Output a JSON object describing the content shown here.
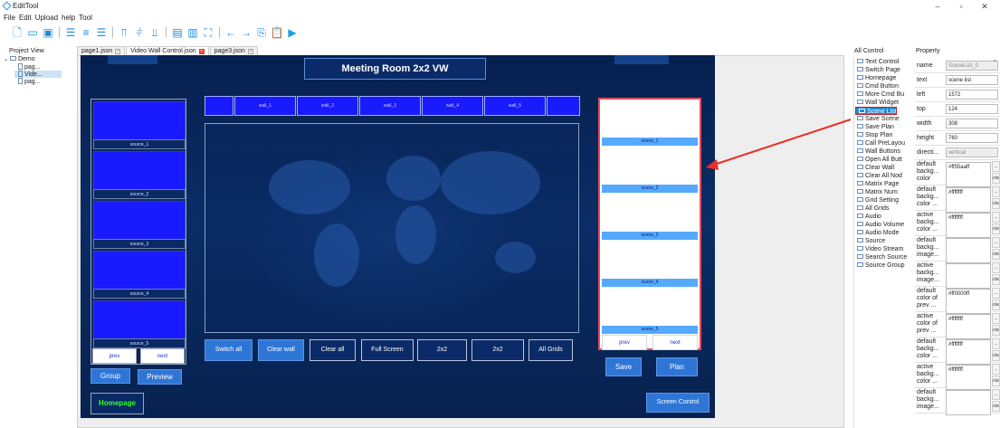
{
  "window": {
    "title": "EditTool",
    "min_icon": "minimize-icon",
    "max_icon": "maximize-icon",
    "close_icon": "close-icon"
  },
  "menu": [
    "File",
    "Edit",
    "Upload",
    "help",
    "Tool"
  ],
  "toolbar": {
    "icons": [
      "new-file-icon",
      "open-folder-icon",
      "save-icon",
      "align-top-icon",
      "align-middle-icon",
      "align-bottom-icon",
      "align-left-icon",
      "align-center-icon",
      "align-right-icon",
      "distribute-horizontal-icon",
      "distribute-vertical-icon",
      "fit-icon",
      "undo-icon",
      "redo-icon",
      "copy-icon",
      "paste-icon",
      "run-icon"
    ]
  },
  "project_view": {
    "title": "Project View",
    "root": "Demo",
    "items": [
      "pag...",
      "Vide...",
      "pag..."
    ],
    "selected_index": 1
  },
  "tabs": [
    {
      "label": "page1.json",
      "active": false
    },
    {
      "label": "Video Wall Control.json",
      "active": true
    },
    {
      "label": "page3.json",
      "active": false
    }
  ],
  "canvas": {
    "room_title": "Meeting Room 2x2 VW",
    "sources": [
      "source_1",
      "source_2",
      "source_3",
      "source_4",
      "source_5"
    ],
    "source_nav": {
      "prev": "prev",
      "next": "next"
    },
    "group_button": "Group",
    "preview_button": "Preview",
    "homepage_button": "Homepage",
    "wall_buttons": [
      "",
      "wall_1",
      "wall_2",
      "wall_3",
      "wall_4",
      "wall_5",
      ""
    ],
    "controls": [
      "Switch all",
      "Clear wall",
      "Clear all",
      "Full Screen",
      "2x2",
      "2x2",
      "All Grids"
    ],
    "scenes": [
      "scene_1",
      "scene_2",
      "scene_3",
      "scene_4",
      "scene_5"
    ],
    "scene_nav": {
      "prev": "prev",
      "next": "next"
    },
    "save_button": "Save",
    "plan_button": "Plan",
    "screen_control_button": "Screen Control"
  },
  "all_control": {
    "title": "All Control",
    "items": [
      "Text Control",
      "Switch Page",
      "Homepage",
      "Cmd Button",
      "More Cmd Bu",
      "Wall Widget",
      "Scene List",
      "Save Scene",
      "Save Plan",
      "Stop Plan",
      "Call PreLayou",
      "Wall Buttons",
      "Open All Butt",
      "Clear Wall",
      "Clear All Nod",
      "Matrix Page",
      "Matrix Num",
      "Grid Setting",
      "All Grids",
      "Audio",
      "Audio Volume",
      "Audio Mode",
      "Source",
      "Video Stream",
      "Search Source",
      "Source Group"
    ],
    "selected_index": 6
  },
  "property": {
    "title": "Property",
    "rows": [
      {
        "key": "name",
        "value": "SceneList_0",
        "grey": true
      },
      {
        "key": "text",
        "value": "scene list"
      },
      {
        "key": "left",
        "value": "1572"
      },
      {
        "key": "top",
        "value": "124"
      },
      {
        "key": "width",
        "value": "308"
      },
      {
        "key": "height",
        "value": "760"
      },
      {
        "key": "directi...",
        "value": "vertical",
        "grey": true
      },
      {
        "key": "default backg... color",
        "value": "#ff55aaff",
        "btn": true
      },
      {
        "key": "default backg... color ...",
        "value": "#ffffffff",
        "btn": true
      },
      {
        "key": "active backg... color ...",
        "value": "#ffffffff",
        "btn": true
      },
      {
        "key": "default backg... image...",
        "value": "",
        "btn": true
      },
      {
        "key": "active backg... image...",
        "value": "",
        "btn": true
      },
      {
        "key": "default color of prev ...",
        "value": "#ff0000ff",
        "btn": true
      },
      {
        "key": "active color of prev ...",
        "value": "#ffffffff",
        "btn": true
      },
      {
        "key": "default backg... color ...",
        "value": "#ffffffff",
        "btn": true
      },
      {
        "key": "active backg... color ...",
        "value": "#ffffffff",
        "btn": true
      },
      {
        "key": "default backg... image...",
        "value": "",
        "btn": true
      }
    ],
    "btn_dots": "...",
    "btn_clear": "clear"
  },
  "colors": {
    "accent": "#2e76d6",
    "canvas_bg": "#0a2d66",
    "source_fill": "#1a1aff",
    "scene_label": "#55aaff",
    "selection": "#1e8bd8",
    "highlight": "#e84b5a"
  }
}
